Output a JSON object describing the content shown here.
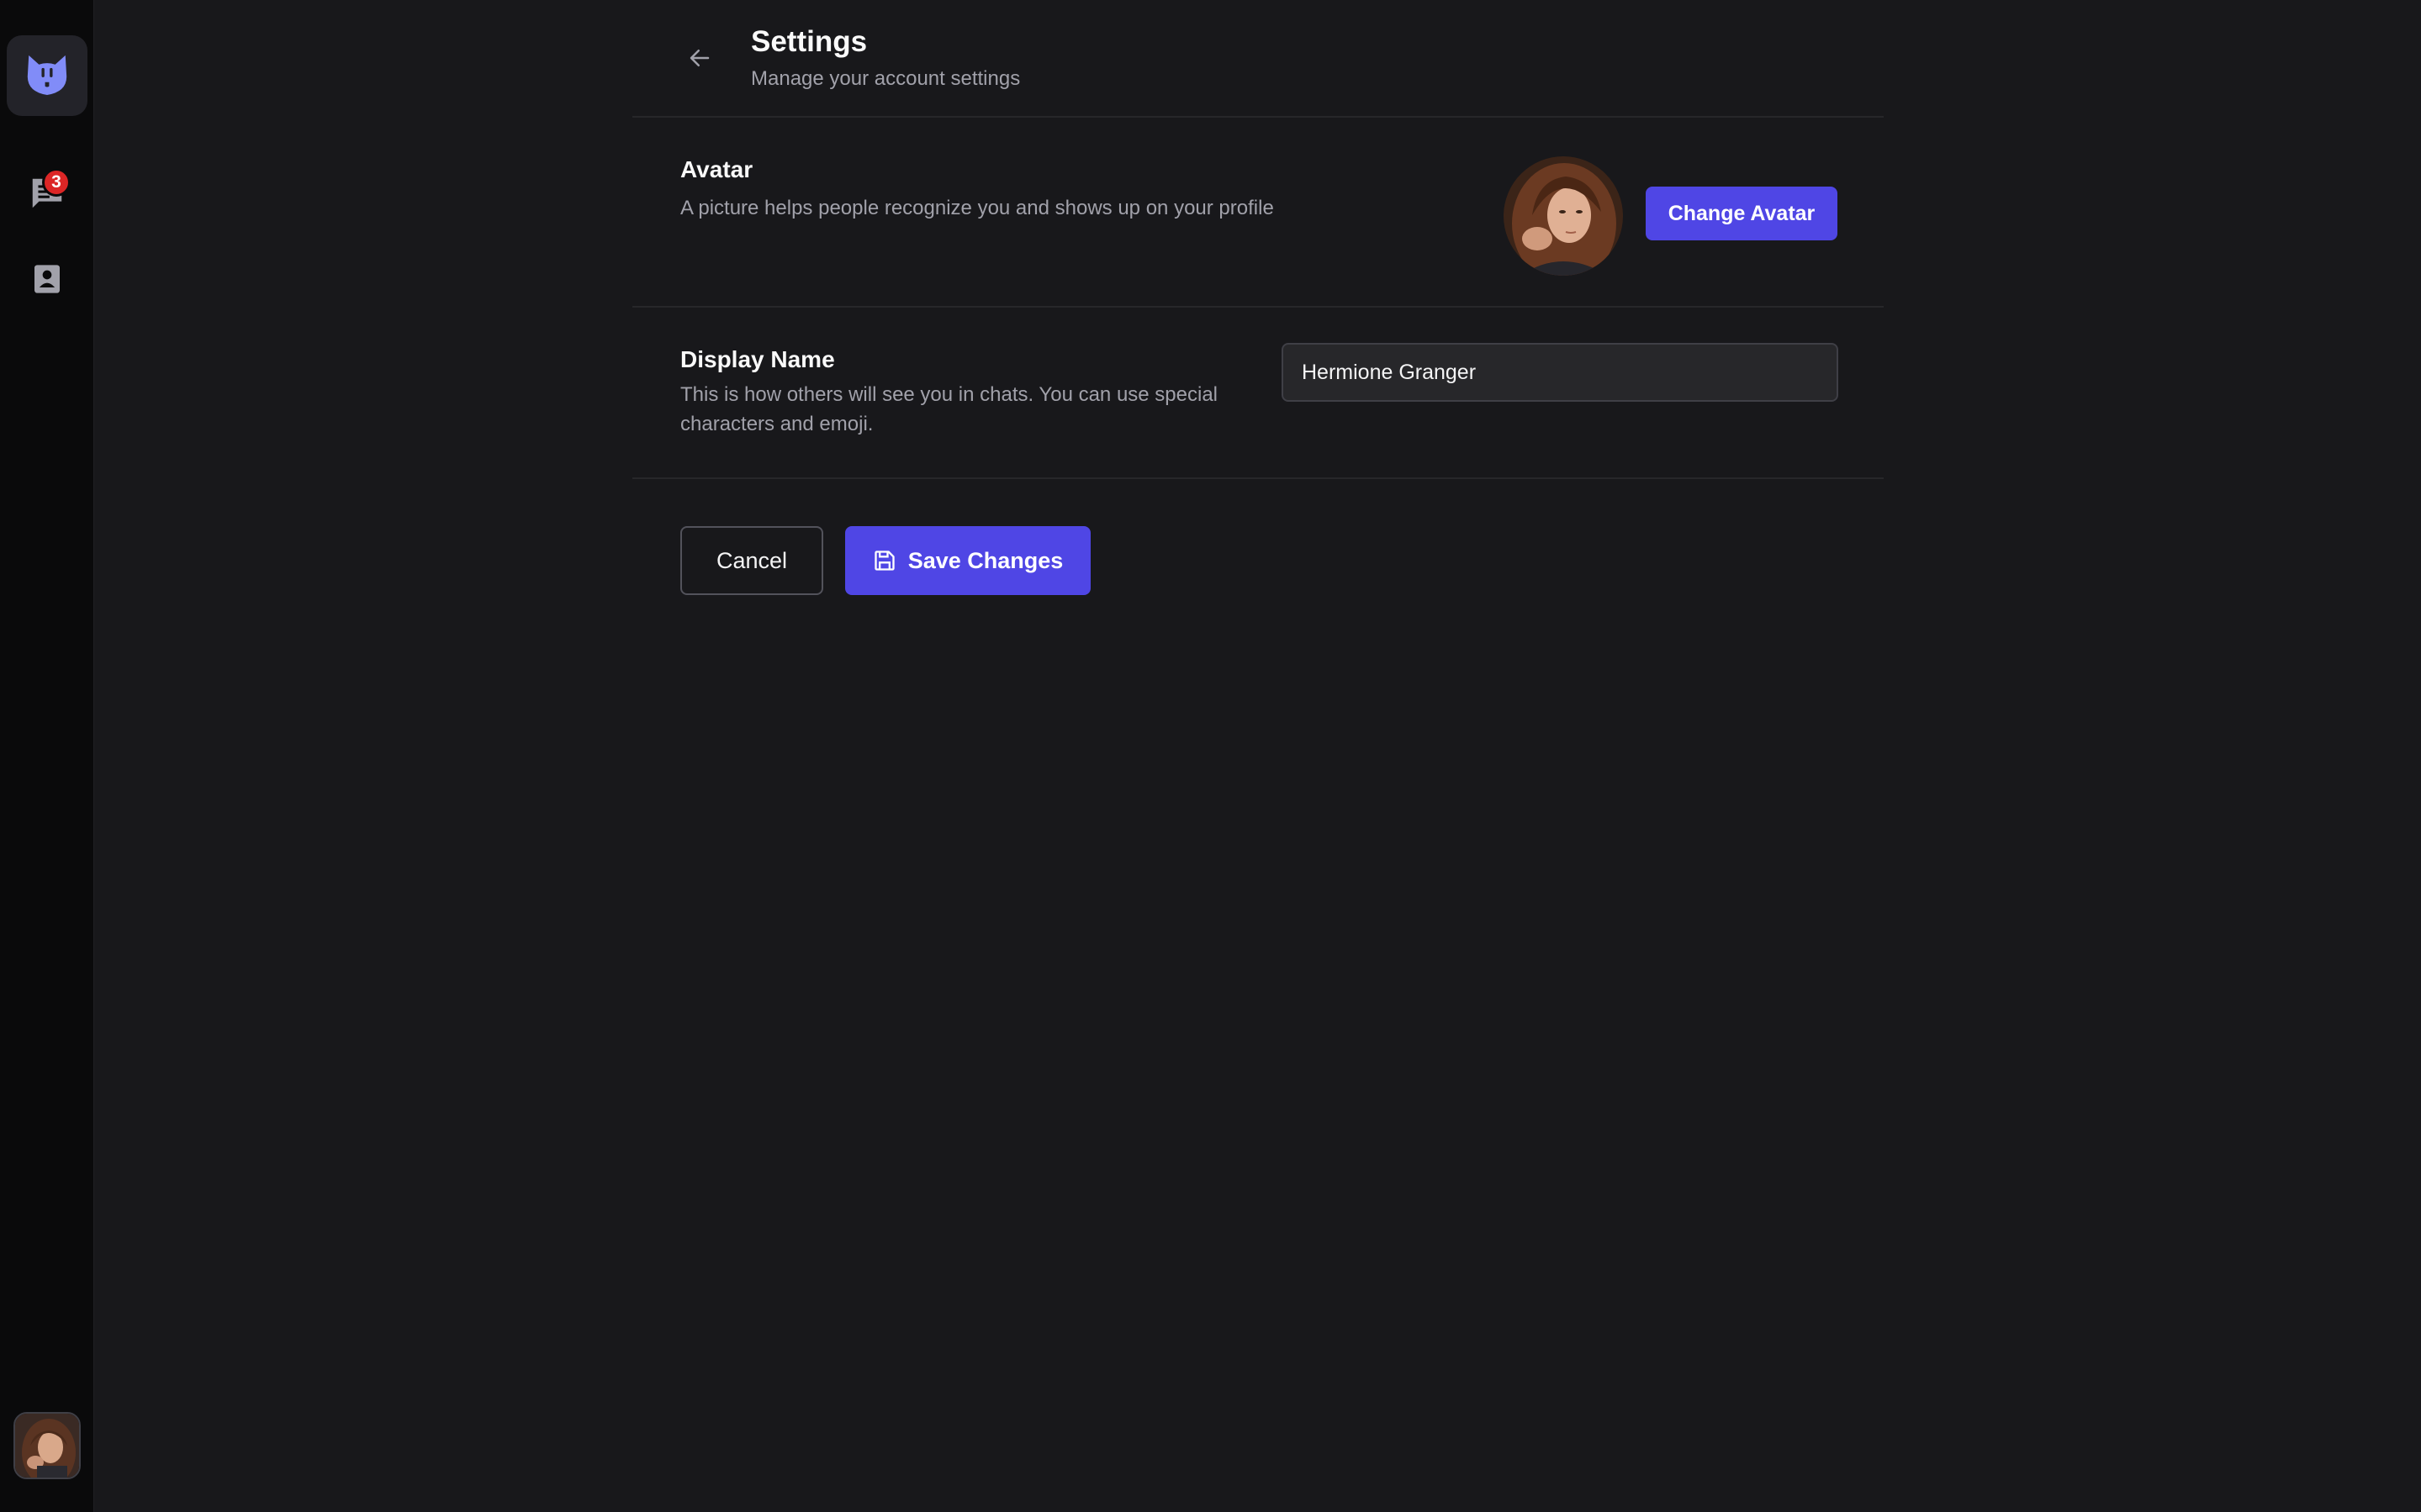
{
  "rail": {
    "logo": "cat-logo-icon",
    "items": [
      {
        "icon": "chat-bubble-icon",
        "badge": "3"
      },
      {
        "icon": "contact-card-icon"
      }
    ],
    "user_avatar": "user-avatar"
  },
  "header": {
    "back_icon": "arrow-left-icon",
    "title": "Settings",
    "subtitle": "Manage your account settings"
  },
  "avatar_section": {
    "title": "Avatar",
    "description": "A picture helps people recognize you and shows up on your profile",
    "button_label": "Change Avatar"
  },
  "display_name_section": {
    "title": "Display Name",
    "description": "This is how others will see you in chats. You can use special characters and emoji.",
    "input_value": "Hermione Granger"
  },
  "actions": {
    "cancel_label": "Cancel",
    "save_label": "Save Changes",
    "save_icon": "floppy-disk-icon"
  },
  "colors": {
    "background": "#18181b",
    "rail": "#0a0a0b",
    "accent": "#4f46e5",
    "logo": "#818cf8",
    "badge": "#dc2626"
  }
}
